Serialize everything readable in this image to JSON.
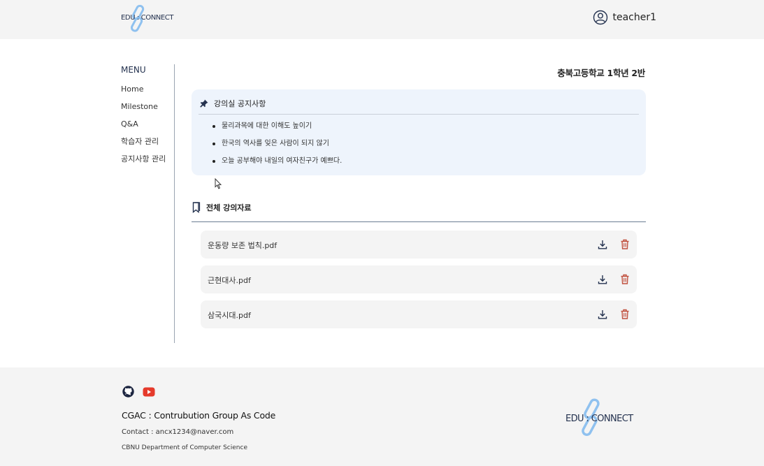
{
  "header": {
    "logo_text": "EDU : CONNECT",
    "username": "teacher1"
  },
  "sidebar": {
    "title": "MENU",
    "items": [
      {
        "label": "Home"
      },
      {
        "label": "Milestone"
      },
      {
        "label": "Q&A"
      },
      {
        "label": "학습자 관리"
      },
      {
        "label": "공지사항 관리"
      }
    ]
  },
  "main": {
    "class_title": "충북고등학교 1학년 2반",
    "notice": {
      "title": "강의실 공지사항",
      "items": [
        "물리과목에 대한 이해도 높이기",
        "한국의 역사를 잊은 사람이 되지 않기",
        "오늘 공부해야 내일의 여자친구가 예쁘다."
      ]
    },
    "materials": {
      "title": "전체 강의자료",
      "files": [
        {
          "name": "운동량 보존 법칙.pdf"
        },
        {
          "name": "근현대사.pdf"
        },
        {
          "name": "삼국시대.pdf"
        }
      ]
    }
  },
  "footer": {
    "org": "CGAC : Contrubution Group As Code",
    "contact": "Contact : ancx1234@naver.com",
    "dept": "CBNU Department of Computer Science",
    "logo_text": "EDU : CONNECT"
  },
  "colors": {
    "accent": "#24324f",
    "chain": "#8fc1ef",
    "notice_bg": "#eef4fc",
    "delete": "#c0503e",
    "youtube": "#e53a2b"
  }
}
